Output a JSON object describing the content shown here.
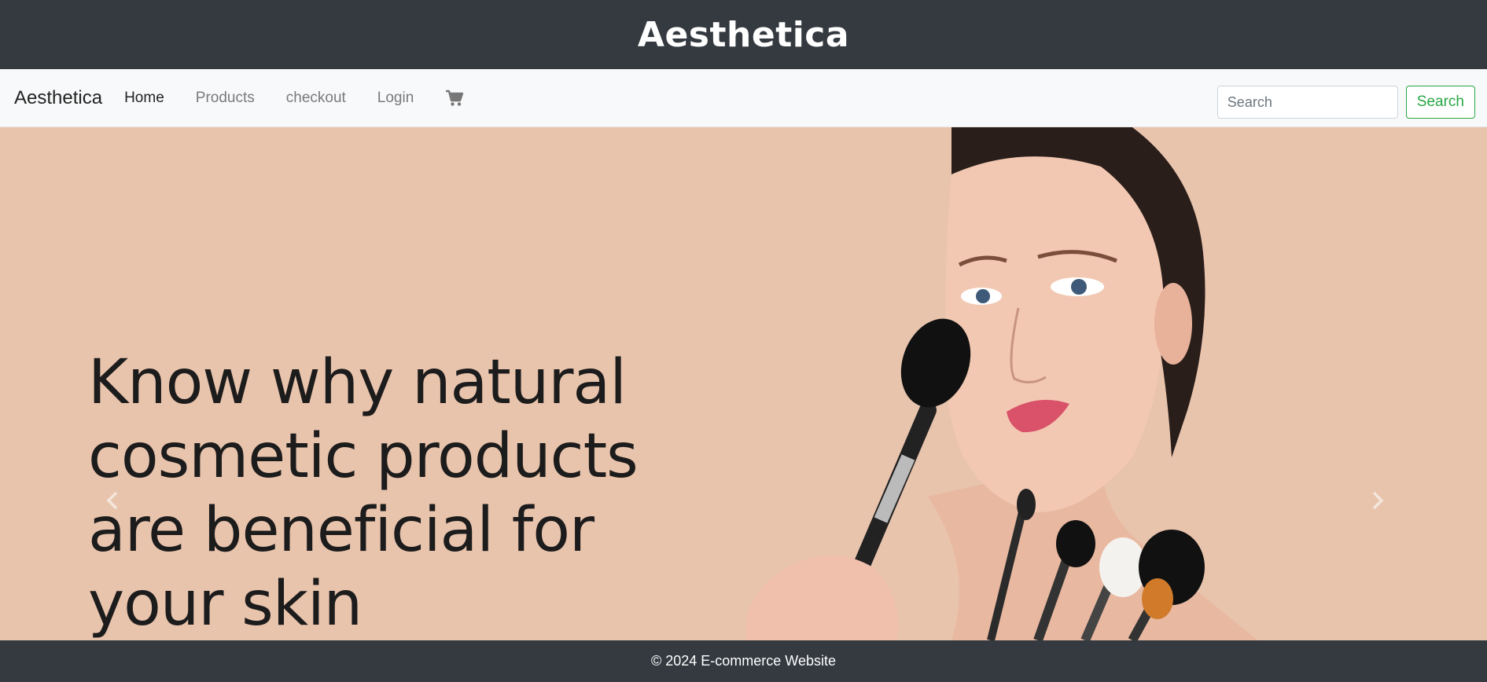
{
  "header": {
    "title": "Aesthetica"
  },
  "navbar": {
    "brand": "Aesthetica",
    "links": [
      {
        "label": "Home",
        "active": true
      },
      {
        "label": "Products",
        "active": false
      },
      {
        "label": "checkout",
        "active": false
      },
      {
        "label": "Login",
        "active": false
      }
    ],
    "cart_icon": "shopping-cart-icon"
  },
  "search": {
    "placeholder": "Search",
    "button_label": "Search",
    "button_color": "#28a745"
  },
  "carousel": {
    "headline_lines": [
      "Know why natural",
      "cosmetic products",
      "are beneficial for",
      "your skin"
    ],
    "background_color": "#e9c4ad",
    "prev_icon": "chevron-left-icon",
    "next_icon": "chevron-right-icon"
  },
  "footer": {
    "text": "© 2024 E-commerce Website"
  },
  "colors": {
    "dark": "#343a40",
    "navbar_bg": "#f8f9fa"
  }
}
